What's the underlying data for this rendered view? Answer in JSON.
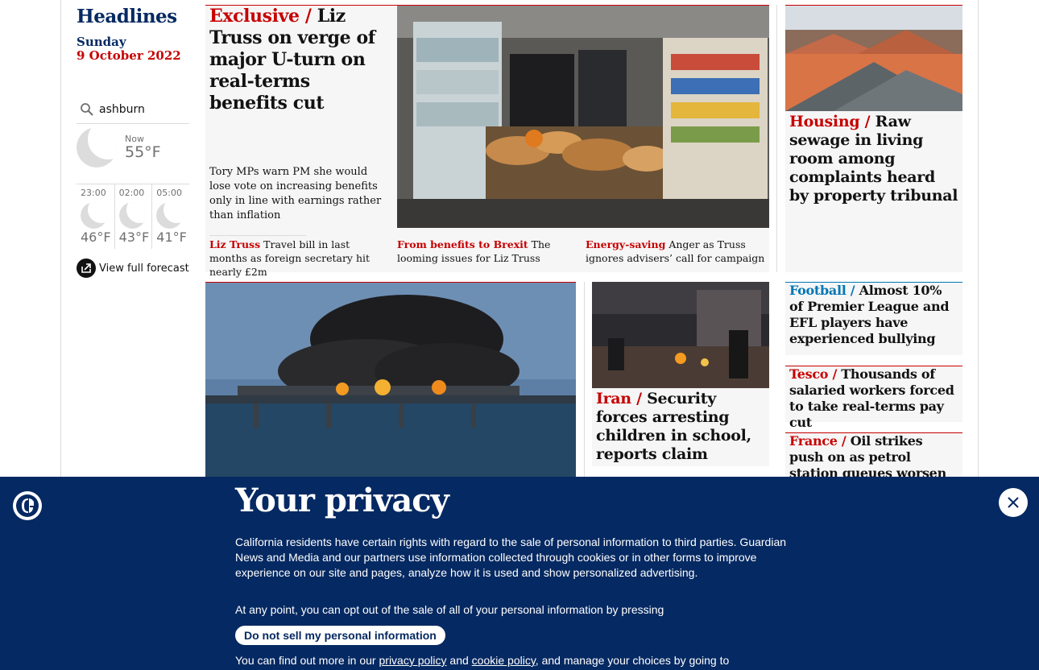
{
  "left_column": {
    "section_title": "Headlines",
    "date_day": "Sunday",
    "date_full": "9 October 2022",
    "weather": {
      "location": "ashburn",
      "now_label": "Now",
      "now_temp": "55°F",
      "forecast": [
        {
          "time": "23:00",
          "temp": "46°F",
          "icon": "moon-icon"
        },
        {
          "time": "02:00",
          "temp": "43°F",
          "icon": "moon-icon"
        },
        {
          "time": "05:00",
          "temp": "41°F",
          "icon": "moon-icon"
        }
      ],
      "full_forecast_label": "View full forecast"
    }
  },
  "lead": {
    "kicker": "Exclusive /",
    "headline": "Liz Truss on verge of major U-turn on real-terms benefits cut",
    "standfirst": "Tory MPs warn PM she would lose vote on increasing benefits only in line with earnings rather than inflation",
    "sublinks": [
      {
        "kicker": "Liz Truss",
        "text": "Travel bill in last months as foreign secretary hit nearly £2m"
      },
      {
        "kicker": "From benefits to Brexit",
        "text": "The looming issues for Liz Truss"
      },
      {
        "kicker": "Energy-saving",
        "text": "Anger as Truss ignores advisers’ call for campaign"
      }
    ]
  },
  "right_stories": [
    {
      "kicker": "Housing /",
      "headline": "Raw sewage in living room among complaints heard by property tribunal"
    },
    {
      "kicker": "Football /",
      "headline": "Almost 10% of Premier League and EFL players have experienced bullying"
    },
    {
      "kicker": "Tesco /",
      "headline": "Thousands of salaried workers forced to take real-terms pay cut"
    },
    {
      "kicker": "France /",
      "headline": "Oil strikes push on as petrol station queues worsen"
    }
  ],
  "iran_story": {
    "kicker": "Iran /",
    "headline": "Security forces arresting children in school, reports claim"
  },
  "privacy_banner": {
    "title": "Your privacy",
    "paragraph1": "California residents have certain rights with regard to the sale of personal information to third parties. Guardian News and Media and our partners use information collected through cookies or in other forms to improve experience on our site and pages, analyze how it is used and show personalized advertising.",
    "paragraph2": "At any point, you can opt out of the sale of all of your personal information by pressing",
    "button_label": "Do not sell my personal information",
    "p3_start": "You can find out more in our",
    "privacy_link": "privacy policy",
    "and": "and",
    "cookie_link": "cookie policy",
    "p3_end": ", and manage your choices by going to"
  },
  "colors": {
    "brand_blue": "#052962",
    "news_red": "#c70000",
    "sport_blue": "#0077b6"
  }
}
